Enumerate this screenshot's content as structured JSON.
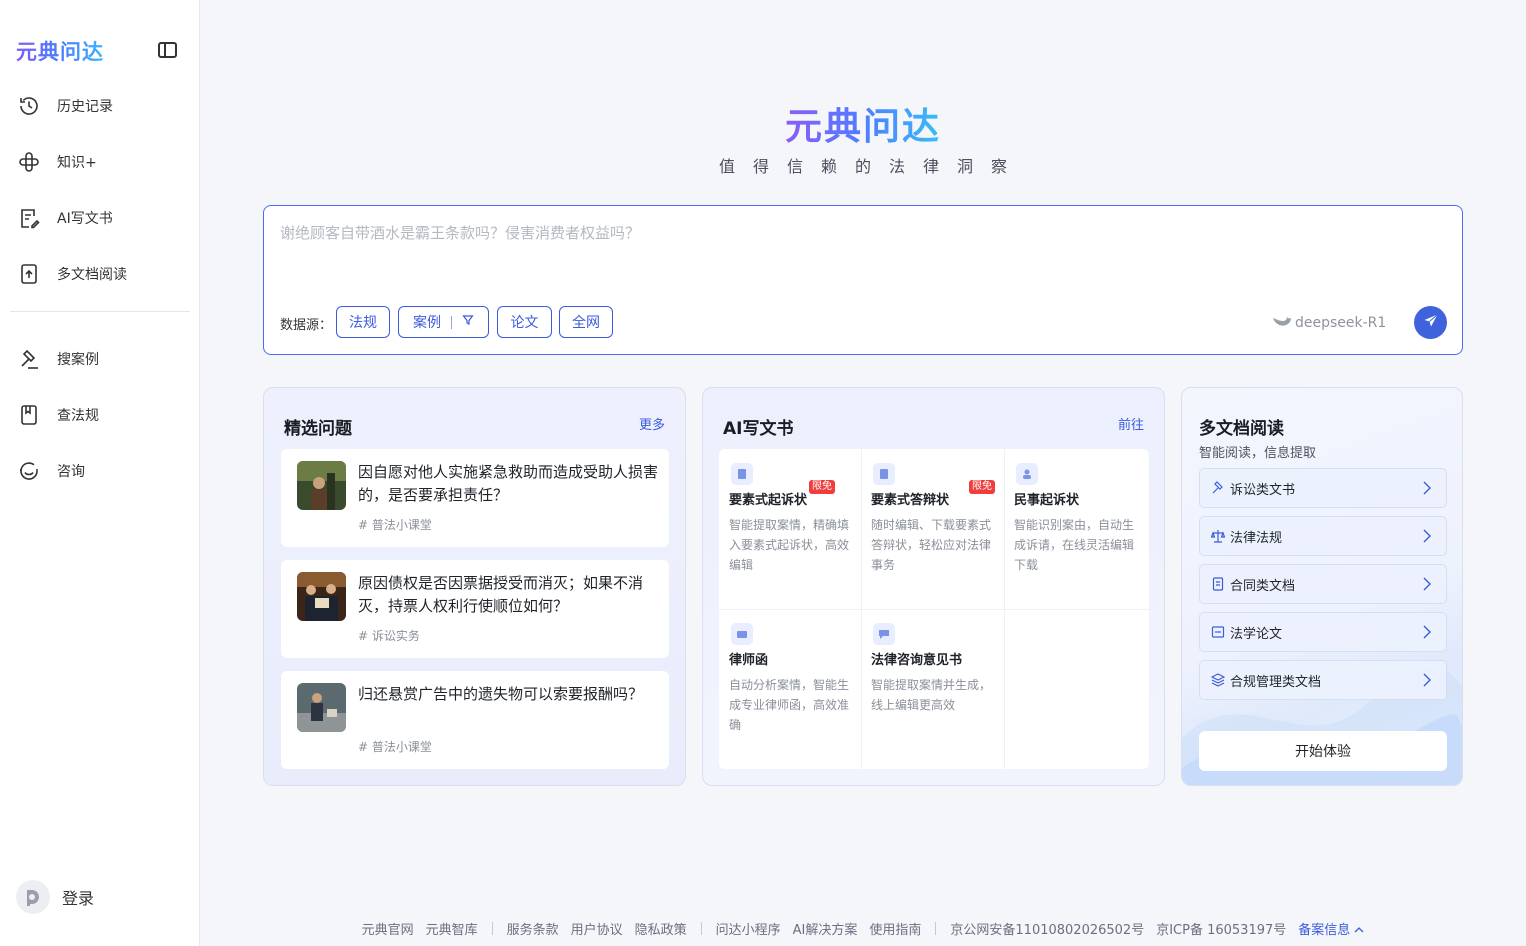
{
  "app": {
    "name": "元典问达"
  },
  "sidebar": {
    "logo": "元典问达",
    "items": [
      {
        "label": "历史记录",
        "icon": "history-icon"
      },
      {
        "label": "知识+",
        "icon": "knowledge-icon"
      },
      {
        "label": "AI写文书",
        "icon": "document-write-icon"
      },
      {
        "label": "多文档阅读",
        "icon": "upload-doc-icon"
      },
      {
        "label": "搜案例",
        "icon": "gavel-icon"
      },
      {
        "label": "查法规",
        "icon": "book-icon"
      },
      {
        "label": "咨询",
        "icon": "consult-icon"
      }
    ],
    "login": "登录"
  },
  "hero": {
    "title": "元典问达",
    "subtitle": "值得信赖的法律洞察"
  },
  "search": {
    "placeholder": "谢绝顾客自带酒水是霸王条款吗？侵害消费者权益吗？",
    "datasource_label": "数据源：",
    "chips": [
      "法规",
      "案例",
      "论文",
      "全网"
    ],
    "model": "deepseek-R1"
  },
  "featured": {
    "title": "精选问题",
    "more": "更多",
    "items": [
      {
        "text": "因自愿对他人实施紧急救助而造成受助人损害的，是否要承担责任？",
        "tag": "# 普法小课堂"
      },
      {
        "text": "原因债权是否因票据授受而消灭；如果不消灭，持票人权利行使顺位如何？",
        "tag": "# 诉讼实务"
      },
      {
        "text": "归还悬赏广告中的遗失物可以索要报酬吗？",
        "tag": "# 普法小课堂"
      }
    ]
  },
  "ai_docs": {
    "title": "AI写文书",
    "more": "前往",
    "items": [
      {
        "name": "要素式起诉状",
        "badge": "限免",
        "desc": "智能提取案情，精确填入要素式起诉状，高效编辑"
      },
      {
        "name": "要素式答辩状",
        "badge": "限免",
        "desc": "随时编辑、下载要素式答辩状，轻松应对法律事务"
      },
      {
        "name": "民事起诉状",
        "badge": "",
        "desc": "智能识别案由，自动生成诉请，在线灵活编辑下载"
      },
      {
        "name": "律师函",
        "badge": "",
        "desc": "自动分析案情，智能生成专业律师函，高效准确"
      },
      {
        "name": "法律咨询意见书",
        "badge": "",
        "desc": "智能提取案情并生成，线上编辑更高效"
      }
    ]
  },
  "multi_doc": {
    "title": "多文档阅读",
    "subtitle": "智能阅读，信息提取",
    "items": [
      {
        "label": "诉讼类文书",
        "icon": "gavel-icon"
      },
      {
        "label": "法律法规",
        "icon": "scale-icon"
      },
      {
        "label": "合同类文档",
        "icon": "contract-icon"
      },
      {
        "label": "法学论文",
        "icon": "paper-icon"
      },
      {
        "label": "合规管理类文档",
        "icon": "layers-icon"
      }
    ],
    "button": "开始体验"
  },
  "footer": {
    "groups": [
      [
        "元典官网",
        "元典智库"
      ],
      [
        "服务条款",
        "用户协议",
        "隐私政策"
      ],
      [
        "问达小程序",
        "AI解决方案",
        "使用指南"
      ],
      [
        "京公网安备11010802026502号",
        "京ICP备 16053197号"
      ]
    ],
    "record_info": "备案信息"
  },
  "colors": {
    "accent": "#3b5bdb",
    "badge": "#f03e3e",
    "send": "#3e63dd"
  }
}
